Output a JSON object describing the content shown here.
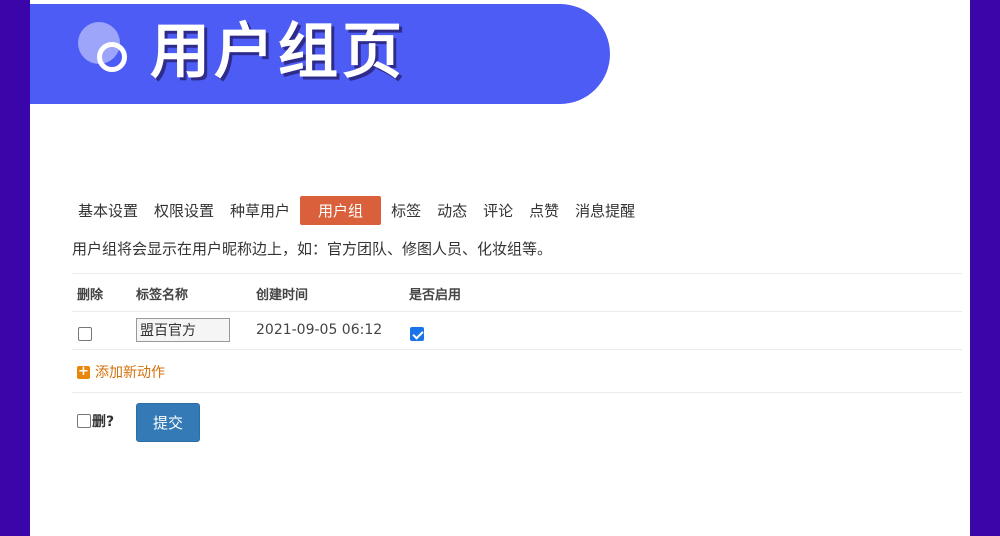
{
  "banner": {
    "title": "用户组页"
  },
  "tabs": [
    {
      "label": "基本设置"
    },
    {
      "label": "权限设置"
    },
    {
      "label": "种草用户"
    },
    {
      "label": "用户组",
      "active": true
    },
    {
      "label": "标签"
    },
    {
      "label": "动态"
    },
    {
      "label": "评论"
    },
    {
      "label": "点赞"
    },
    {
      "label": "消息提醒"
    }
  ],
  "description": "用户组将会显示在用户昵称边上，如：官方团队、修图人员、化妆组等。",
  "table": {
    "headers": {
      "delete": "删除",
      "name": "标签名称",
      "created": "创建时间",
      "enabled": "是否启用"
    },
    "rows": [
      {
        "delete": false,
        "name": "盟百官方",
        "created": "2021-09-05 06:12",
        "enabled": true
      }
    ]
  },
  "add_action_label": "添加新动作",
  "footer": {
    "delete_label": "删?",
    "submit_label": "提交"
  },
  "colors": {
    "background": "#3a06a9",
    "banner": "#4c5cf5",
    "active_tab": "#d9603b",
    "submit": "#337ab7",
    "add_action": "#d4700a"
  }
}
